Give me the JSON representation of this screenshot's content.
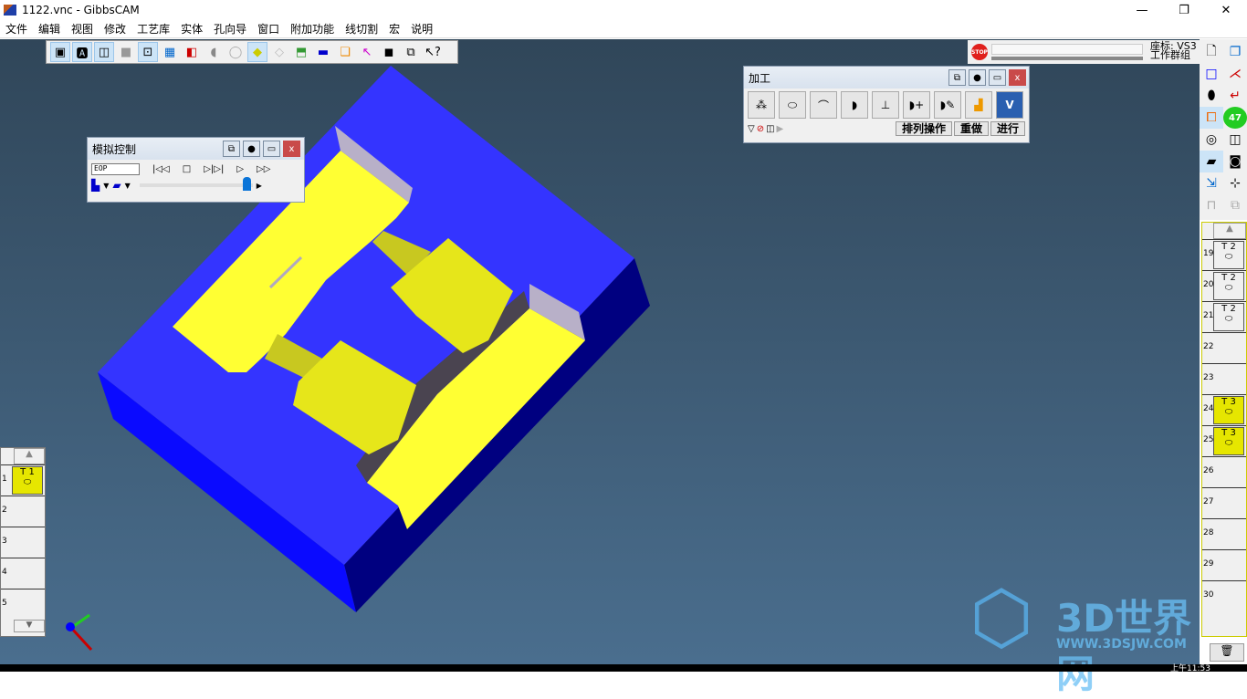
{
  "window": {
    "title": "1122.vnc - GibbsCAM",
    "min": "—",
    "max": "❐",
    "close": "✕"
  },
  "menu": [
    "文件",
    "编辑",
    "视图",
    "修改",
    "工艺库",
    "实体",
    "孔向导",
    "窗口",
    "附加功能",
    "线切割",
    "宏",
    "说明"
  ],
  "toolbar": {
    "icons": [
      "frame-view-icon",
      "text-frame-icon",
      "shaded-box-icon",
      "solid-box-icon",
      "select-point-icon",
      "grid-icon",
      "red-blue-solid-icon",
      "cylinder-icon",
      "outline-cylinder-icon",
      "yellow-cube-icon",
      "wire-cube-icon",
      "layer-cube-icon",
      "tool-bar-icon",
      "stack-icon",
      "pick-line-icon",
      "two-windows-icon",
      "rotate-cube-icon",
      "help-pointer-icon"
    ]
  },
  "status": {
    "stop": "STOP",
    "coord_label": "座标: VS3",
    "group_label": "工作群组"
  },
  "machining": {
    "title": "加工",
    "ops": [
      "drill-icon",
      "contour-icon",
      "open-contour-icon",
      "pocket-icon",
      "thread-mill-icon",
      "pocket-add-icon",
      "pocket-edit-icon",
      "surface-icon",
      "verify-icon"
    ],
    "buttons": {
      "sort": "排列操作",
      "redo": "重做",
      "run": "进行"
    }
  },
  "sim": {
    "title": "模拟控制",
    "field": "EOP",
    "buttons": [
      "|◁◁",
      "□",
      "▷|▷|",
      "▷",
      "▷▷"
    ],
    "slider_percent": 95
  },
  "right_list": {
    "slots": [
      {
        "n": "19",
        "tool": "T 2",
        "color": "gray"
      },
      {
        "n": "20",
        "tool": "T 2",
        "color": "gray"
      },
      {
        "n": "21",
        "tool": "T 2",
        "color": "gray"
      },
      {
        "n": "22"
      },
      {
        "n": "23"
      },
      {
        "n": "24",
        "tool": "T 3",
        "color": "yellow"
      },
      {
        "n": "25",
        "tool": "T 3",
        "color": "yellow"
      },
      {
        "n": "26"
      },
      {
        "n": "27"
      },
      {
        "n": "28"
      },
      {
        "n": "29"
      },
      {
        "n": "30"
      }
    ]
  },
  "left_list": {
    "slots": [
      {
        "n": "1",
        "tool": "T 1",
        "color": "yellow"
      },
      {
        "n": "2"
      },
      {
        "n": "3"
      },
      {
        "n": "4"
      },
      {
        "n": "5"
      }
    ]
  },
  "badge": "47",
  "watermark": {
    "text": "3D世界网",
    "url": "WWW.3DSJW.COM"
  },
  "clock": "上午11:53",
  "colors": {
    "part": "#3434ff",
    "machined": "#ffff33",
    "viewport": "#3d5a74"
  }
}
